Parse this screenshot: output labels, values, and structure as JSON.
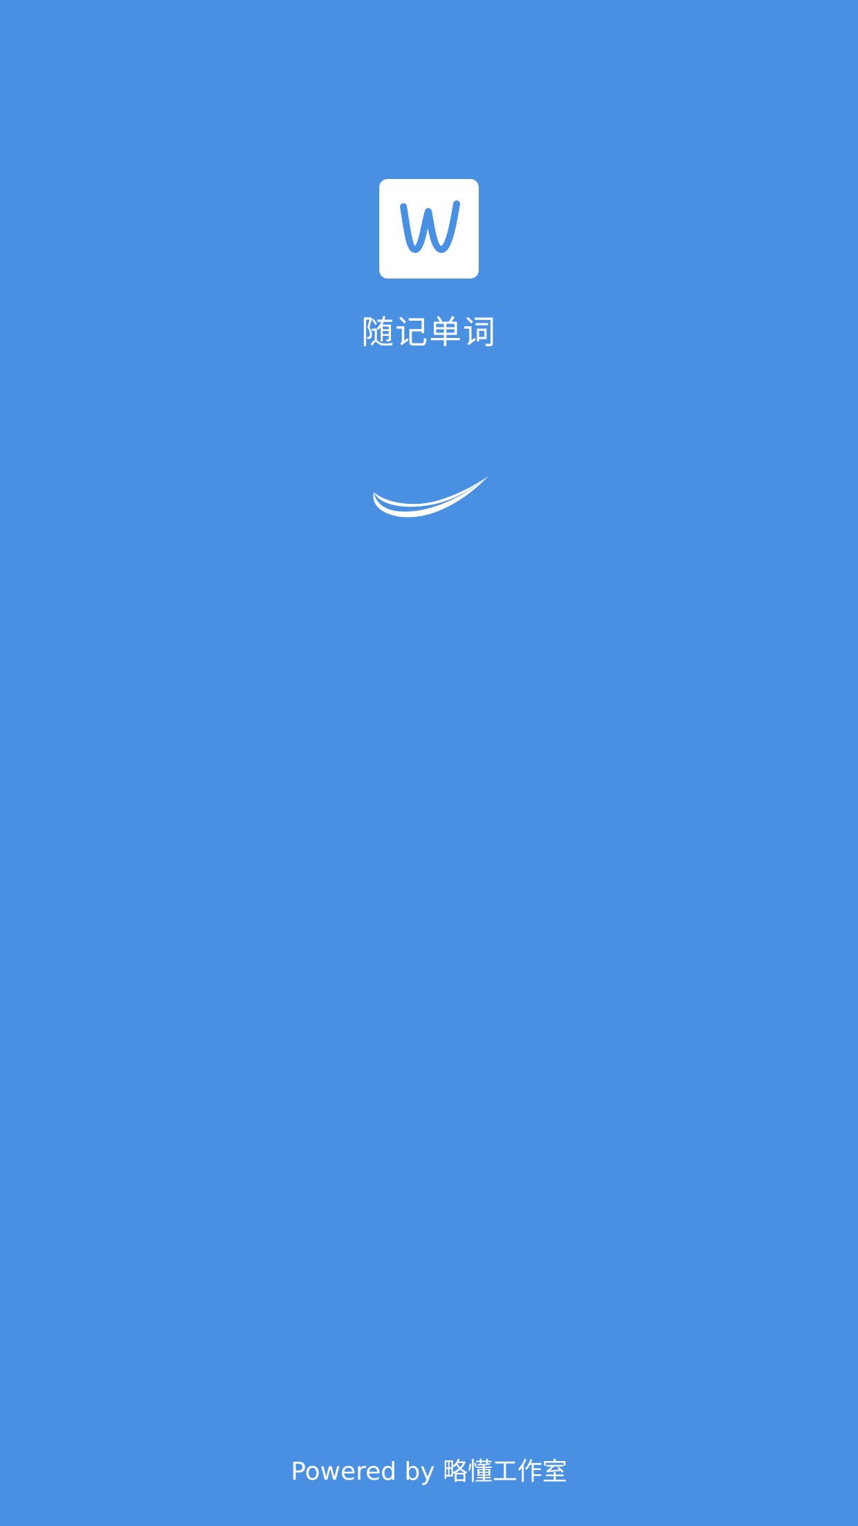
{
  "app": {
    "name": "随记单词",
    "logo_letter": "W",
    "logo_icon": "w-letter-logo-icon",
    "loading_icon": "loading-swoosh-icon"
  },
  "footer": {
    "powered_by": "Powered by 略懂工作室"
  },
  "colors": {
    "background": "#4A90E2",
    "foreground": "#FFFFFF"
  }
}
